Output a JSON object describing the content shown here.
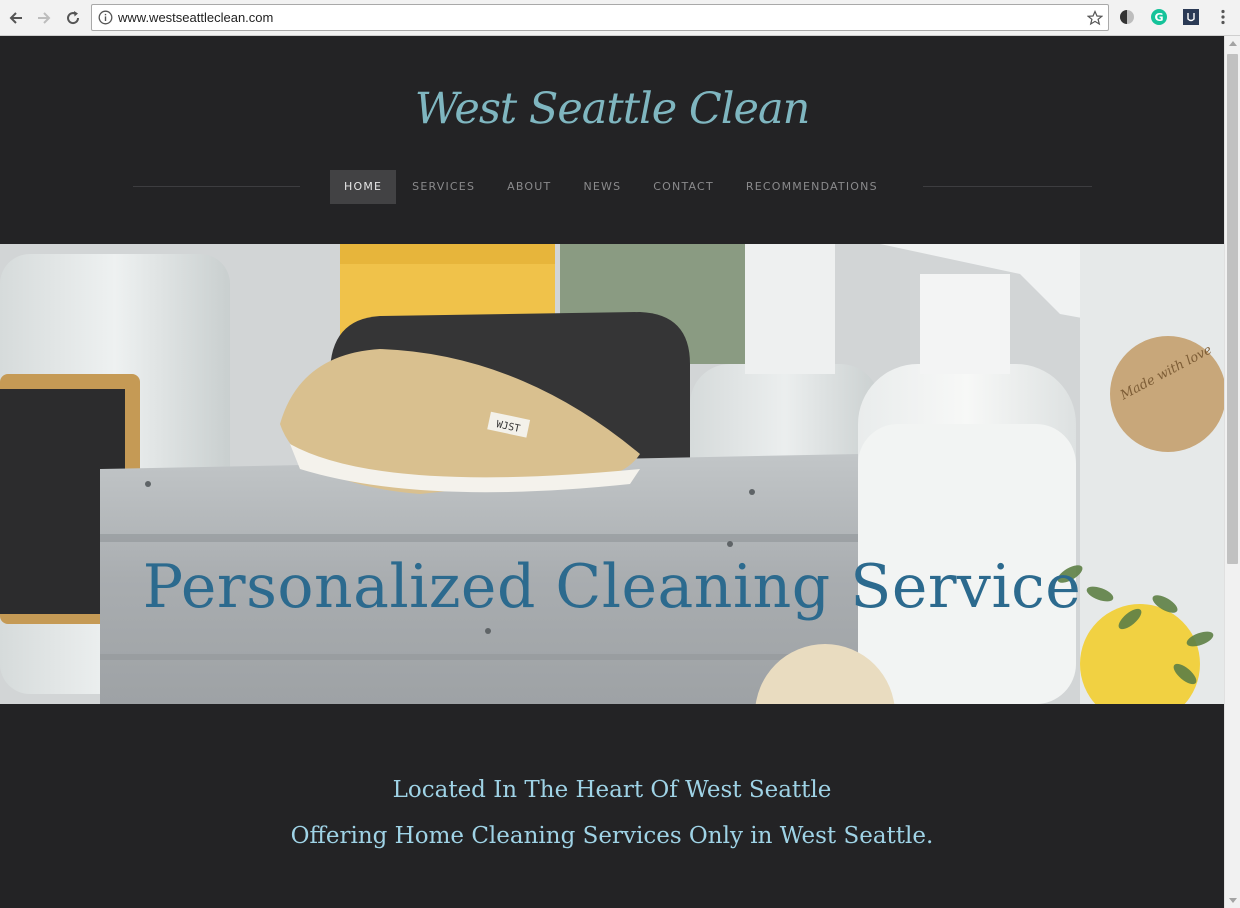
{
  "browser": {
    "url": "www.westseattleclean.com",
    "icons": [
      "back-arrow-icon",
      "forward-arrow-icon",
      "reload-icon",
      "info-icon",
      "star-icon",
      "extension-halfcircle-icon",
      "grammarly-icon",
      "extension-square-icon",
      "menu-dots-icon"
    ]
  },
  "site": {
    "title": "West Seattle Clean"
  },
  "nav": {
    "items": [
      {
        "label": "HOME"
      },
      {
        "label": "SERVICES"
      },
      {
        "label": "ABOUT"
      },
      {
        "label": "NEWS"
      },
      {
        "label": "CONTACT"
      },
      {
        "label": "RECOMMENDATIONS"
      }
    ],
    "active_index": 0
  },
  "hero": {
    "headline": "Personalized Cleaning Service",
    "sponge_text": "WJST",
    "label_text": "Made with love"
  },
  "content": {
    "line1": "Located In The Heart Of West Seattle",
    "line2": "Offering Home Cleaning Services Only in West Seattle."
  },
  "colors": {
    "page_bg": "#232325",
    "title": "#7fb6c0",
    "headline": "#2c6a8e",
    "tagline": "#9fd3e6",
    "nav_active_bg": "#424244"
  }
}
